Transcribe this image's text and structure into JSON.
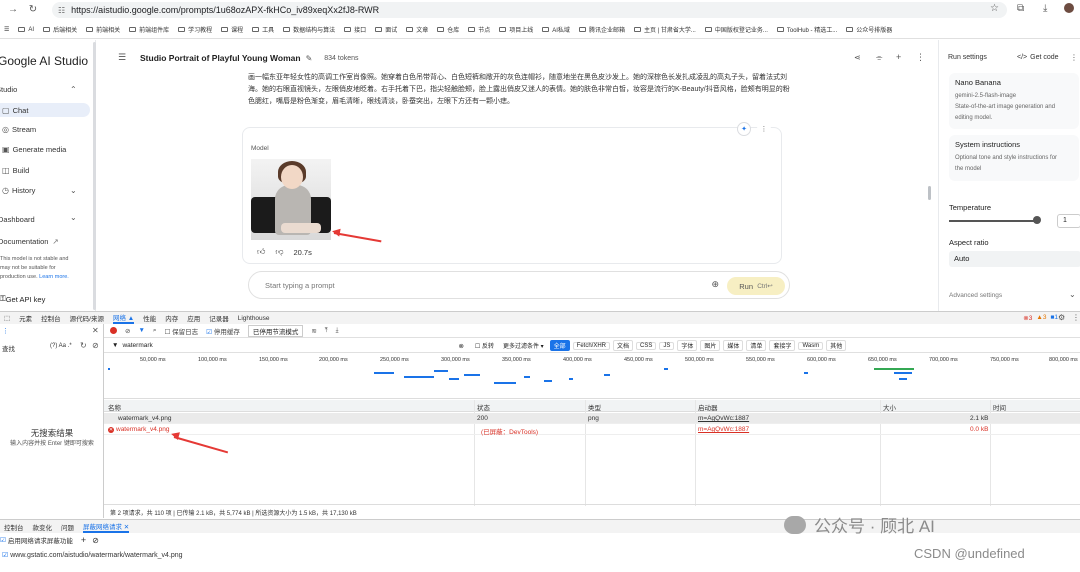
{
  "browser": {
    "url": "https://aistudio.google.com/prompts/1u68ozAPX-fkHCo_iv89xeqXx2fJ8-RWR",
    "bookmarks": [
      "AI",
      "后端相关",
      "前端相关",
      "前端组件库",
      "学习教程",
      "课程",
      "工具",
      "数据结构与算法",
      "接口",
      "面试",
      "文章",
      "仓库",
      "节点",
      "项目上线",
      "AI私域",
      "腾讯企业邮箱",
      "主页 | 甘肃省大学...",
      "中国版权登记业务...",
      "ToolHub - 精选工...",
      "公众号排版器"
    ]
  },
  "studio": {
    "logo": "Google AI Studio",
    "nav": {
      "studio": "Studio",
      "chat": "Chat",
      "stream": "Stream",
      "generate_media": "Generate media",
      "build": "Build",
      "history": "History",
      "dashboard": "Dashboard",
      "documentation": "Documentation"
    },
    "note_lines": [
      "This model is not stable and",
      "may not be suitable for",
      "production use."
    ],
    "learn_more": "Learn more.",
    "get_api_key": "Get API key",
    "prompt_title": "Studio Portrait of Playful Young Woman",
    "tokens": "834 tokens",
    "prompt_text": "画一幅东亚年轻女性的高调工作室肖像照。她穿着白色吊带背心、白色短裤和敞开的灰色连帽衫，随意地坐在黑色皮沙发上。她的深棕色长发扎成凌乱的高丸子头，留着法式刘海。她的右眼直视镜头，左眼俏皮地眨着。右手托着下巴，指尖轻触脸颊，脸上露出俏皮又迷人的表情。她的肤色非常白皙，妆容是流行的K-Beauty/抖音风格，脸颊有明显的粉色腮红，嘴唇是粉色渐变，眉毛清晰，眼线清淡，卧蚕突出，左眼下方还有一颗小痣。",
    "model_label": "Model",
    "gen_time": "20.7s",
    "input_placeholder": "Start typing a prompt",
    "run_label": "Run",
    "run_shortcut": "Ctrl↩"
  },
  "run_settings": {
    "title": "Run settings",
    "get_code": "Get code",
    "model_name": "Nano Banana",
    "model_desc": [
      "gemini-2.5-flash-image",
      "State-of-the-art image generation and",
      "editing model."
    ],
    "sys_title": "System instructions",
    "sys_desc": [
      "Optional tone and style instructions for",
      "the model"
    ],
    "temperature_label": "Temperature",
    "temperature": "1",
    "aspect_label": "Aspect ratio",
    "aspect_value": "Auto",
    "advanced": "Advanced settings"
  },
  "devtools": {
    "tabs": [
      "元素",
      "控制台",
      "源代码/来源",
      "网络 ▲",
      "性能",
      "内存",
      "应用",
      "记录器",
      "Lighthouse"
    ],
    "counts": {
      "errors": "3",
      "warnings": "3",
      "info": "1"
    },
    "search_label": "查找",
    "search_opts": "(?)  Aa  .*",
    "no_result": "无搜索结果",
    "no_result_hint": "输入内容并按 Enter 键即可搜索",
    "net_toolbar": {
      "preserve_log": "保留日志",
      "disable_cache": "停用缓存",
      "throttle": "已停用节流模式"
    },
    "filter_value": "watermark",
    "filter_chips": [
      "反转",
      "更多过滤条件 ▾",
      "全部",
      "Fetch/XHR",
      "文档",
      "CSS",
      "JS",
      "字体",
      "图片",
      "媒体",
      "清单",
      "套接字",
      "Wasm",
      "其他"
    ],
    "ticks": [
      "50,000 ms",
      "100,000 ms",
      "150,000 ms",
      "200,000 ms",
      "250,000 ms",
      "300,000 ms",
      "350,000 ms",
      "400,000 ms",
      "450,000 ms",
      "500,000 ms",
      "550,000 ms",
      "600,000 ms",
      "650,000 ms",
      "700,000 ms",
      "750,000 ms",
      "800,000 ms"
    ],
    "columns": {
      "name": "名称",
      "status": "状态",
      "type": "类型",
      "initiator": "启动器",
      "size": "大小",
      "time": "时间"
    },
    "requests": [
      {
        "name": "watermark_v4.png",
        "status": "200",
        "type": "png",
        "initiator": "m=AgQvWc:1887",
        "size": "2.1 kB"
      },
      {
        "name": "watermark_v4.png",
        "status": "(已屏蔽：DevTools)",
        "type": "",
        "initiator": "m=AgQvWc:1887",
        "size": "0.0 kB"
      }
    ],
    "summary": "第 2 项请求，共 110 项  |  已传输 2.1 kB，共 5,774 kB  |  所选资源大小为 1.5 kB，共 17,130 kB",
    "drawer_tabs": [
      "控制台",
      "款变化",
      "问题",
      "屏蔽网络请求 ✕"
    ],
    "drawer_enable": "启用网络请求屏蔽功能",
    "blocked_url": "www.gstatic.com/aistudio/watermark/watermark_v4.png"
  },
  "watermarks": {
    "wechat": "公众号 · 顾北 AI",
    "csdn": "CSDN @undefined"
  }
}
